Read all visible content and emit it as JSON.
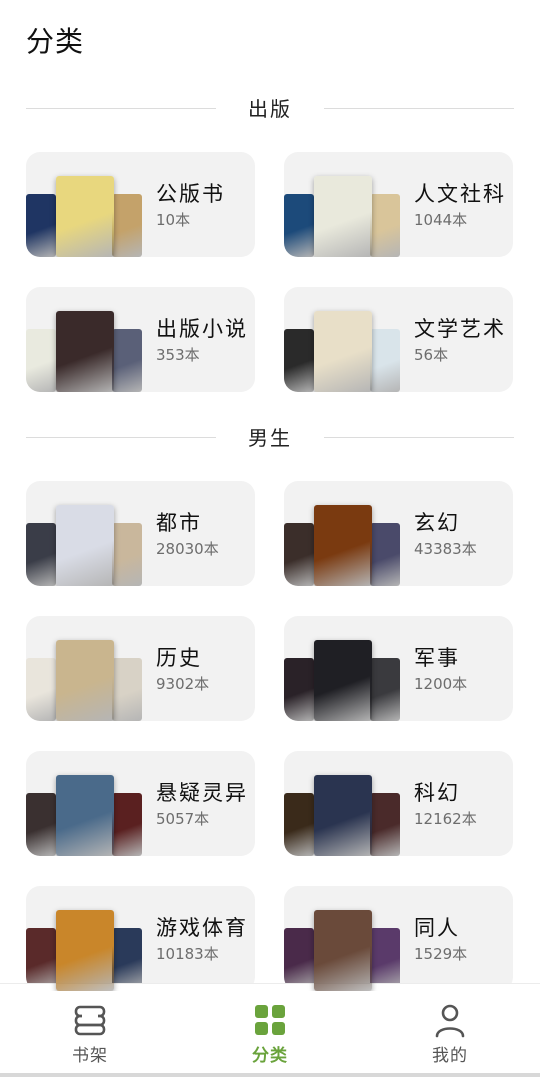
{
  "page": {
    "title": "分类"
  },
  "sections": [
    {
      "title": "出版",
      "categories": [
        {
          "name": "公版书",
          "count": "10本",
          "covers": [
            "#1f3563",
            "#e8d77e",
            "#c4a26a"
          ]
        },
        {
          "name": "人文社科",
          "count": "1044本",
          "covers": [
            "#1c4a7a",
            "#e9e9dc",
            "#d9c59a"
          ]
        },
        {
          "name": "出版小说",
          "count": "353本",
          "covers": [
            "#e9eadf",
            "#3a2a2a",
            "#5a6078"
          ]
        },
        {
          "name": "文学艺术",
          "count": "56本",
          "covers": [
            "#2a2a2a",
            "#e8dfc8",
            "#d9e4ea"
          ]
        }
      ]
    },
    {
      "title": "男生",
      "categories": [
        {
          "name": "都市",
          "count": "28030本",
          "covers": [
            "#3a3d48",
            "#d9dce6",
            "#c9b79c"
          ]
        },
        {
          "name": "玄幻",
          "count": "43383本",
          "covers": [
            "#3b2e2a",
            "#7a3a10",
            "#4a4a6a"
          ]
        },
        {
          "name": "历史",
          "count": "9302本",
          "covers": [
            "#e9e5dc",
            "#c9b58e",
            "#d8d2c6"
          ]
        },
        {
          "name": "军事",
          "count": "1200本",
          "covers": [
            "#2a2228",
            "#1f1f24",
            "#3a3a3e"
          ]
        },
        {
          "name": "悬疑灵异",
          "count": "5057本",
          "covers": [
            "#3a3030",
            "#4a6a8a",
            "#5a2020"
          ]
        },
        {
          "name": "科幻",
          "count": "12162本",
          "covers": [
            "#3a2a1a",
            "#2a3450",
            "#4a2a2a"
          ]
        },
        {
          "name": "游戏体育",
          "count": "10183本",
          "covers": [
            "#5a2a2a",
            "#c9862a",
            "#2a3a5a"
          ]
        },
        {
          "name": "同人",
          "count": "1529本",
          "covers": [
            "#4a2a4a",
            "#6a4a3a",
            "#5a3a6a"
          ]
        }
      ]
    }
  ],
  "nav": {
    "items": [
      {
        "label": "书架",
        "icon": "bookshelf-icon"
      },
      {
        "label": "分类",
        "icon": "category-grid-icon",
        "active": true
      },
      {
        "label": "我的",
        "icon": "profile-icon"
      }
    ],
    "active_color": "#6aa33c",
    "inactive_color": "#555555"
  }
}
